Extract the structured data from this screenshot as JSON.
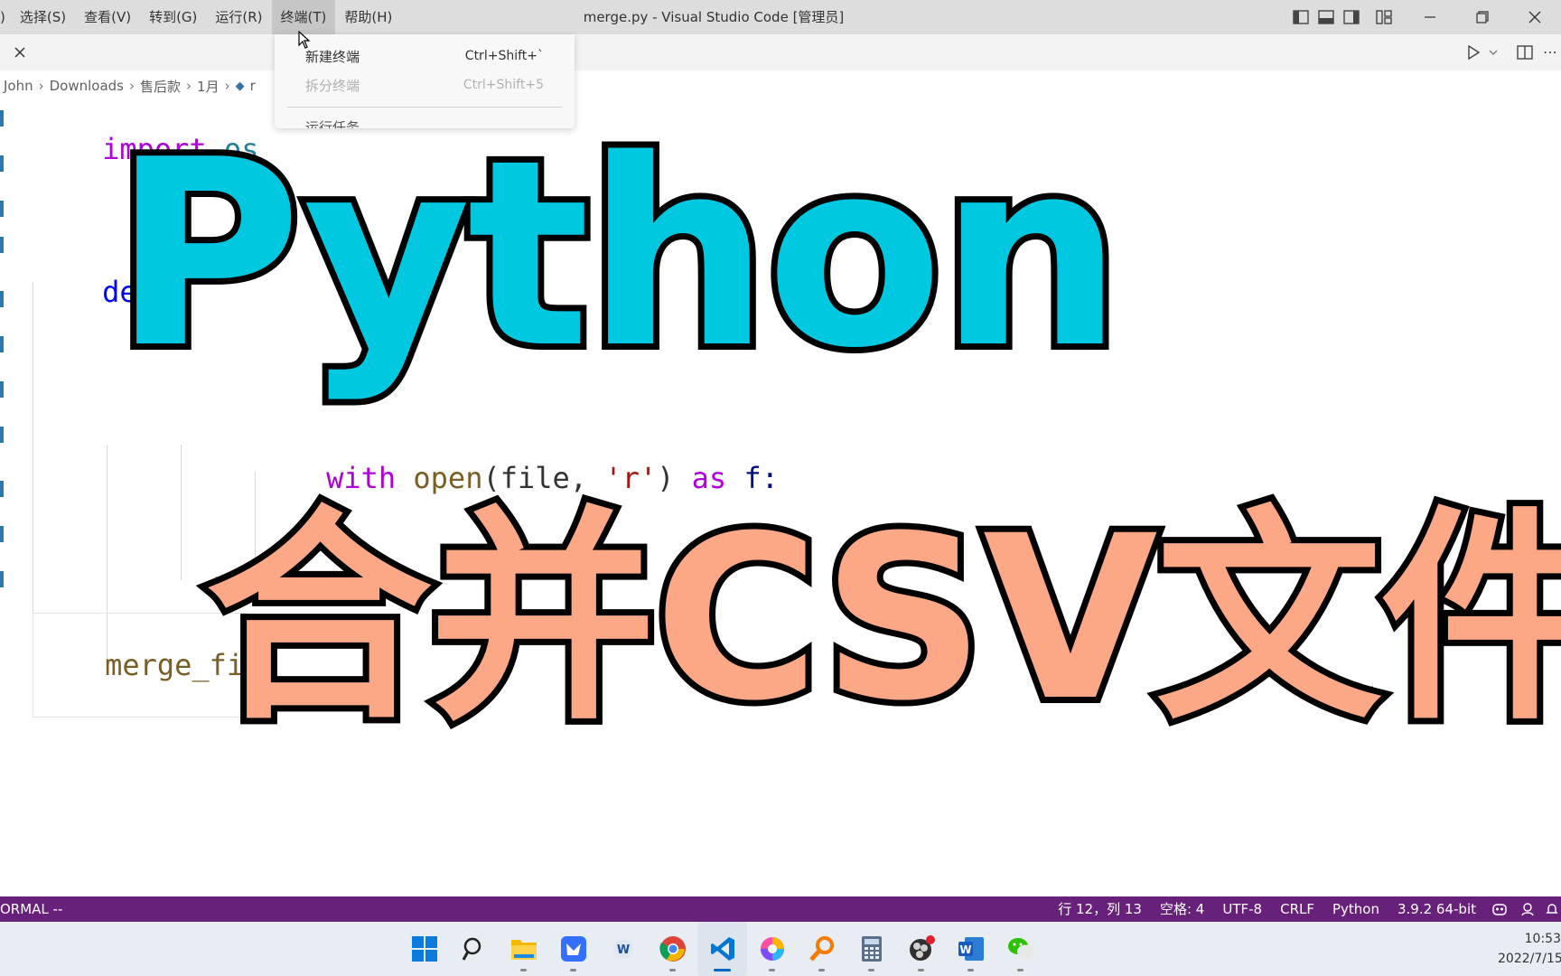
{
  "titlebar": {
    "menu": [
      {
        "label": ")",
        "active": false
      },
      {
        "label": "选择(S)",
        "active": false
      },
      {
        "label": "查看(V)",
        "active": false
      },
      {
        "label": "转到(G)",
        "active": false
      },
      {
        "label": "运行(R)",
        "active": false
      },
      {
        "label": "终端(T)",
        "active": true
      },
      {
        "label": "帮助(H)",
        "active": false
      }
    ],
    "window_title": "merge.py - Visual Studio Code [管理员]"
  },
  "breadcrumb": [
    "John",
    "Downloads",
    "售后款",
    "1月",
    "r"
  ],
  "terminal_menu": {
    "items": [
      {
        "label": "新建终端",
        "shortcut": "Ctrl+Shift+`",
        "enabled": true
      },
      {
        "label": "拆分终端",
        "shortcut": "Ctrl+Shift+5",
        "enabled": false
      }
    ],
    "cut_item": "运行任务"
  },
  "code": {
    "line1_kw": "import",
    "line1_mod": "os",
    "line2_kw": "de",
    "line3_kw": "with",
    "line3_fn": "open",
    "line3_arg": "(file, ",
    "line3_str": "'r'",
    "line3_close": ")",
    "line3_as": "as",
    "line3_var": "f:",
    "line4_fn": "merge_fi"
  },
  "overlay": {
    "title": "Python",
    "subtitle": "合并CSV文件"
  },
  "statusbar": {
    "mode": "ORMAL --",
    "position": "行 12，列 13",
    "spaces": "空格: 4",
    "encoding": "UTF-8",
    "eol": "CRLF",
    "language": "Python",
    "interpreter": "3.9.2 64-bit",
    "color": "#68217a"
  },
  "taskbar": {
    "apps": [
      "windows-start",
      "search",
      "file-explorer",
      "feishu",
      "word-alt",
      "chrome",
      "vscode",
      "photos",
      "search-tool",
      "calculator",
      "obs",
      "word",
      "wechat"
    ],
    "time": "10:53",
    "date": "2022/7/15"
  },
  "colors": {
    "python_title": "#00c8e0",
    "subtitle": "#fca887",
    "accent": "#0067c0"
  }
}
